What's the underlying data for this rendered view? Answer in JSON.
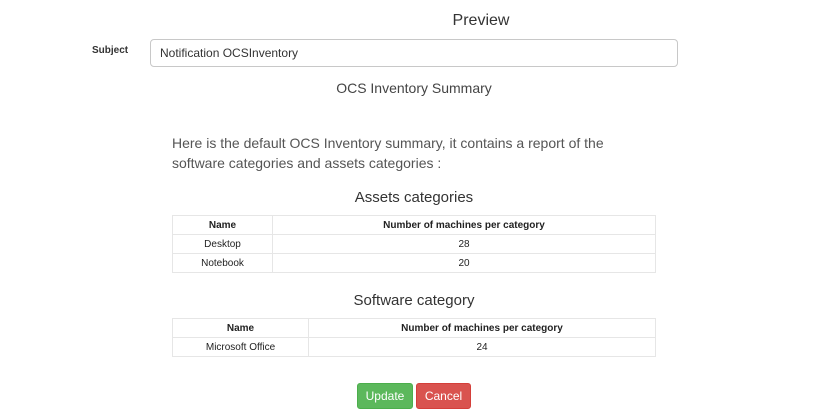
{
  "preview": {
    "title": "Preview"
  },
  "subject": {
    "label": "Subject",
    "value": "Notification OCSInventory"
  },
  "summary": {
    "heading": "OCS Inventory Summary",
    "intro": "Here is the default OCS Inventory summary, it contains a report of the software categories and assets categories :"
  },
  "assets": {
    "title": "Assets categories",
    "columns": [
      "Name",
      "Number of machines per category"
    ],
    "rows": [
      [
        "Desktop",
        "28"
      ],
      [
        "Notebook",
        "20"
      ]
    ]
  },
  "software": {
    "title": "Software category",
    "columns": [
      "Name",
      "Number of machines per category"
    ],
    "rows": [
      [
        "Microsoft Office",
        "24"
      ]
    ]
  },
  "buttons": {
    "update": "Update",
    "cancel": "Cancel"
  },
  "colors": {
    "update": "#5cb85c",
    "cancel": "#d9534f"
  }
}
